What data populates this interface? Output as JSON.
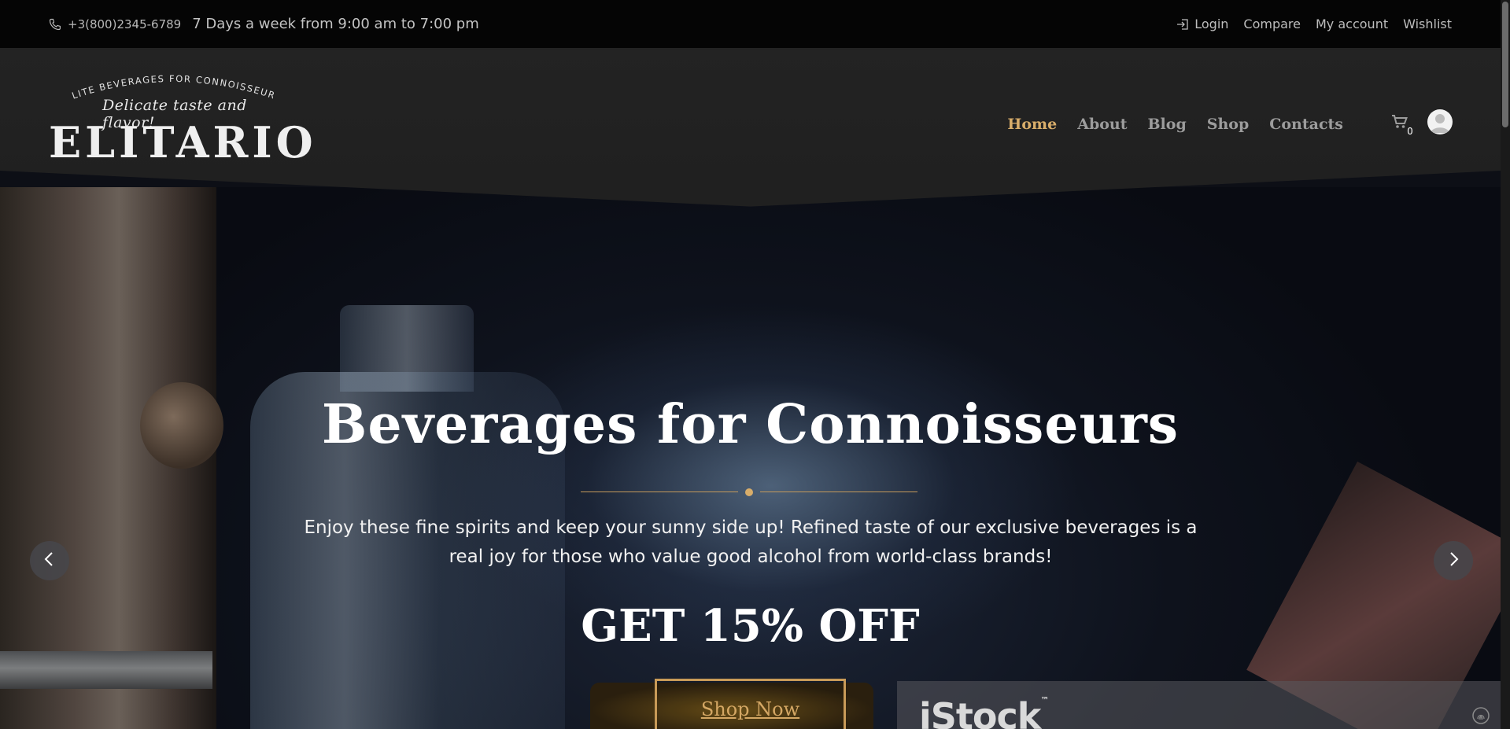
{
  "topbar": {
    "phone": "+3(800)2345-6789",
    "hours": "7 Days a week from 9:00 am to 7:00 pm",
    "links": {
      "login": "Login",
      "compare": "Compare",
      "account": "My account",
      "wishlist": "Wishlist"
    }
  },
  "header": {
    "logo": {
      "arc_text": "ELITE BEVERAGES FOR CONNOISSEURS",
      "tagline": "Delicate taste and flavor!",
      "name": "ELITARIO"
    },
    "nav": {
      "home": "Home",
      "about": "About",
      "blog": "Blog",
      "shop": "Shop",
      "contacts": "Contacts"
    },
    "cart_count": "0"
  },
  "hero": {
    "title": "Beverages for Connoisseurs",
    "text": "Enjoy these fine spirits and keep your sunny side up! Refined taste of our exclusive beverages is a real joy for those who value good alcohol from world-class brands!",
    "offer": "GET 15% OFF",
    "button": "Shop Now",
    "watermark": "iStock",
    "watermark_tm": "™"
  },
  "colors": {
    "accent": "#d8ad6a",
    "topbar_bg": "#050505",
    "header_bg": "#222222"
  },
  "icons": [
    "phone-icon",
    "login-icon",
    "cart-icon",
    "user-avatar-icon",
    "chevron-left-icon",
    "chevron-right-icon"
  ]
}
